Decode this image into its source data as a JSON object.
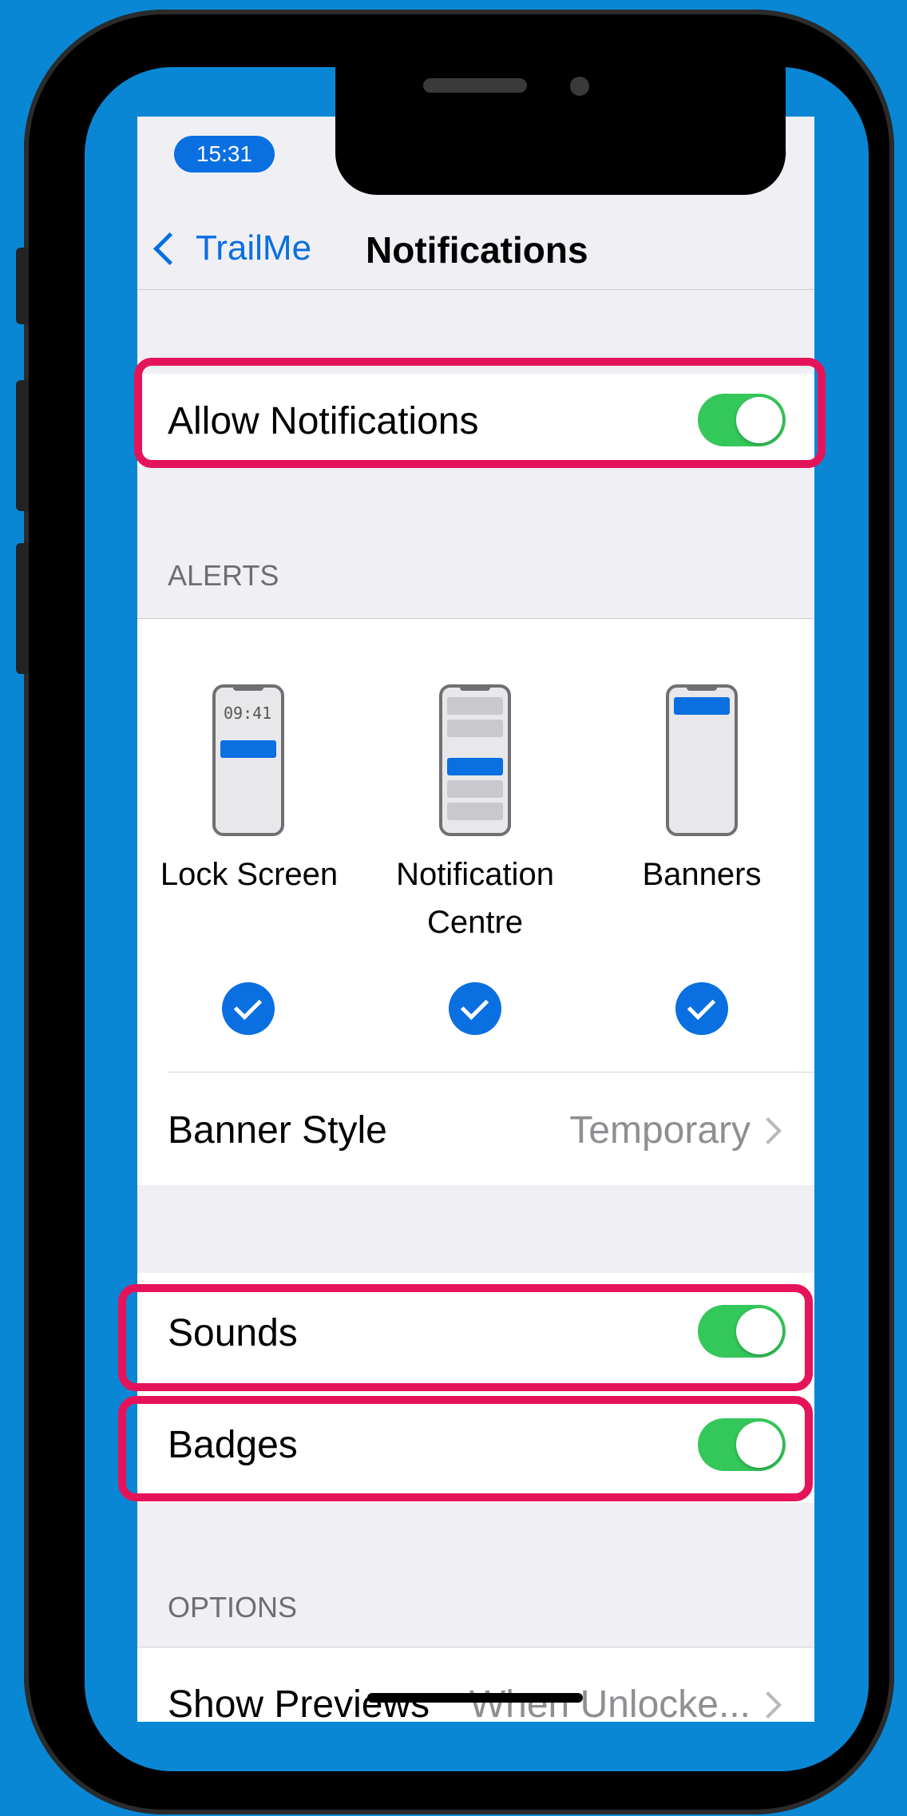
{
  "status_bar": {
    "time": "15:31"
  },
  "nav": {
    "back_label": "TrailMe",
    "title": "Notifications"
  },
  "allow_notifications": {
    "label": "Allow Notifications",
    "enabled": true
  },
  "alerts": {
    "header": "ALERTS",
    "styles": [
      {
        "label": "Lock Screen",
        "preview_time": "09:41",
        "checked": true
      },
      {
        "label": "Notification Centre",
        "checked": true
      },
      {
        "label": "Banners",
        "checked": true
      }
    ],
    "banner_style": {
      "label": "Banner Style",
      "value": "Temporary"
    }
  },
  "sounds": {
    "label": "Sounds",
    "enabled": true
  },
  "badges": {
    "label": "Badges",
    "enabled": true
  },
  "options": {
    "header": "OPTIONS",
    "show_previews": {
      "label": "Show Previews",
      "value": "When Unlocke..."
    }
  },
  "colors": {
    "accent": "#0a6fe0",
    "toggle_on": "#34c759",
    "highlight": "#e5145a",
    "background": "#0a87d4"
  }
}
